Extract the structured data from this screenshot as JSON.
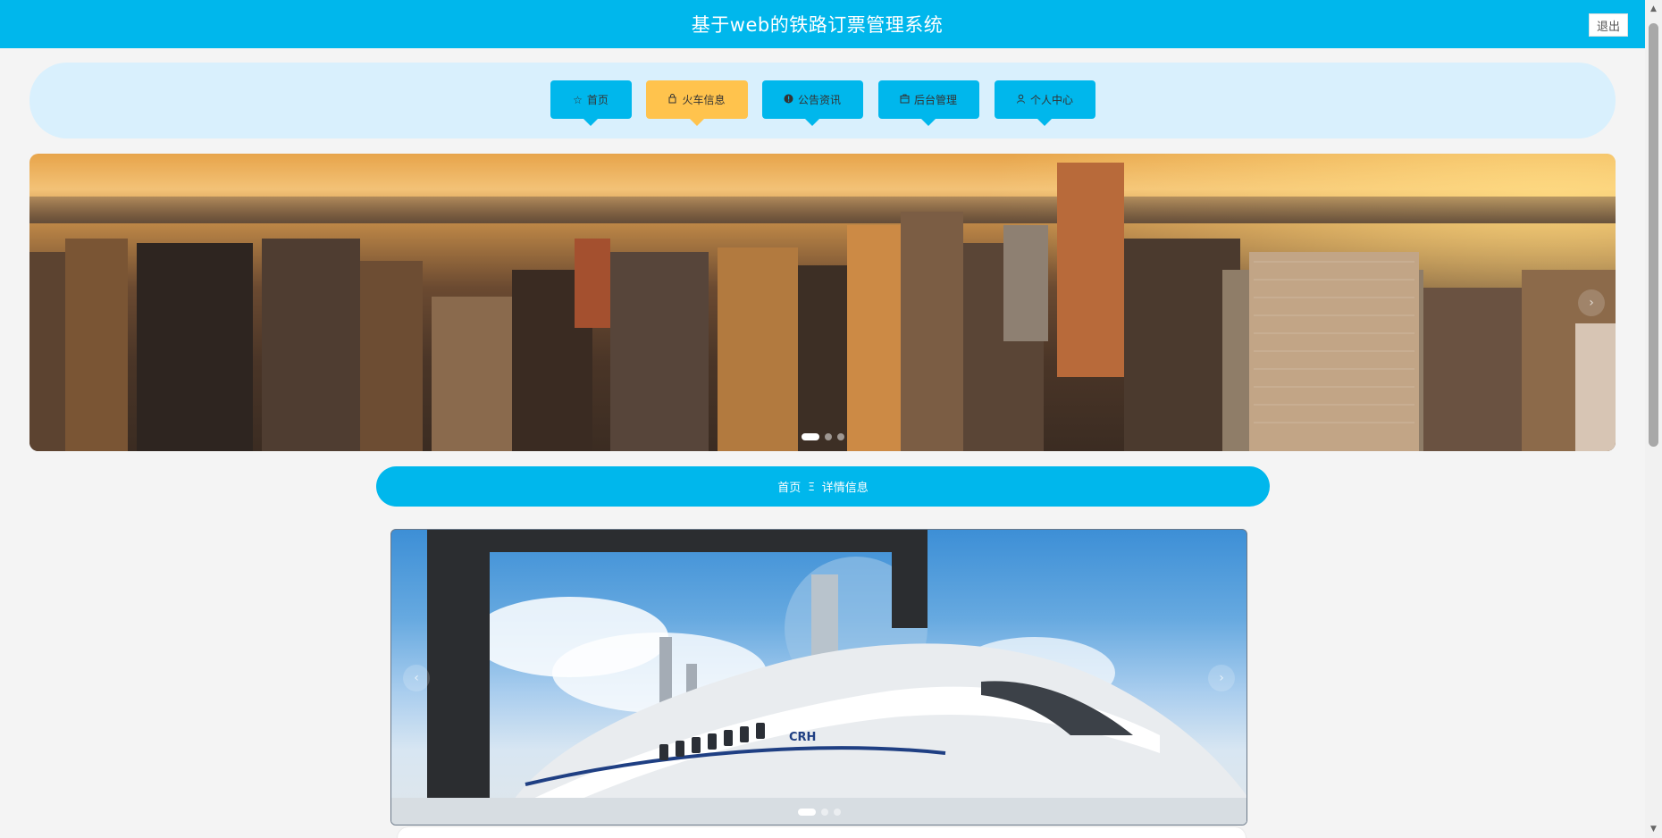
{
  "header": {
    "title": "基于web的铁路订票管理系统",
    "logout_label": "退出"
  },
  "nav": {
    "items": [
      {
        "label": "首页",
        "icon": "star-icon",
        "glyph": "☆"
      },
      {
        "label": "火车信息",
        "icon": "bag-icon",
        "glyph": "⌂"
      },
      {
        "label": "公告资讯",
        "icon": "info-icon",
        "glyph": "●"
      },
      {
        "label": "后台管理",
        "icon": "box-icon",
        "glyph": "▣"
      },
      {
        "label": "个人中心",
        "icon": "user-icon",
        "glyph": "♙"
      }
    ],
    "active_index": 1
  },
  "banner": {
    "slide_count": 3,
    "active_slide": 0,
    "next_glyph": "›"
  },
  "breadcrumb": {
    "home": "首页",
    "separator": "Ξ",
    "current": "详情信息"
  },
  "detail_carousel": {
    "slide_count": 3,
    "active_slide": 0,
    "prev_glyph": "‹",
    "next_glyph": "›",
    "train_text": "CRH"
  },
  "colors": {
    "primary": "#00b7ec",
    "active_nav": "#ffc34d",
    "nav_bg": "#d9f0fd"
  }
}
